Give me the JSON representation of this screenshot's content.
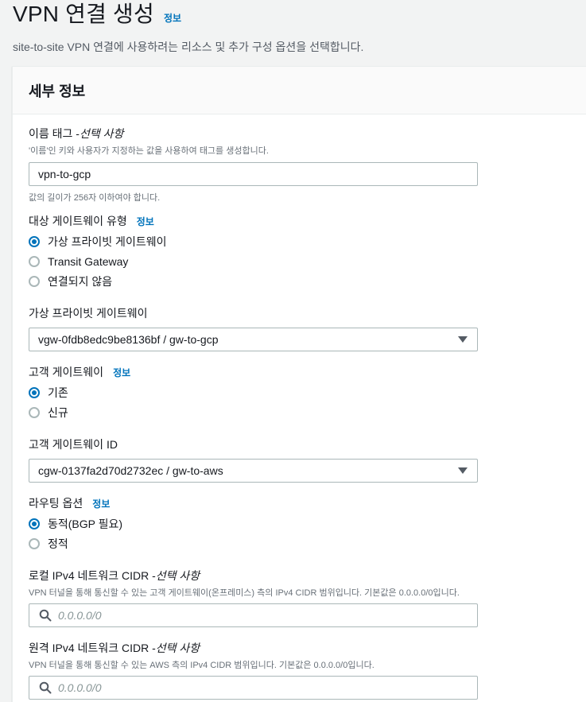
{
  "header": {
    "title": "VPN 연결 생성",
    "info": "정보",
    "description": "site-to-site VPN 연결에 사용하려는 리소스 및 추가 구성 옵션을 선택합니다."
  },
  "panel": {
    "title": "세부 정보"
  },
  "name_tag": {
    "label": "이름 태그 - ",
    "optional": "선택 사항",
    "description": "'이름'인 키와 사용자가 지정하는 값을 사용하여 태그를 생성합니다.",
    "value": "vpn-to-gcp",
    "constraint": "값의 길이가 256자 이하여야 합니다."
  },
  "target_gateway_type": {
    "label": "대상 게이트웨이 유형",
    "info": "정보",
    "options": [
      "가상 프라이빗 게이트웨이",
      "Transit Gateway",
      "연결되지 않음"
    ],
    "selected_index": 0
  },
  "virtual_private_gateway": {
    "label": "가상 프라이빗 게이트웨이",
    "value": "vgw-0fdb8edc9be8136bf / gw-to-gcp"
  },
  "customer_gateway": {
    "label": "고객 게이트웨이",
    "info": "정보",
    "options": [
      "기존",
      "신규"
    ],
    "selected_index": 0
  },
  "customer_gateway_id": {
    "label": "고객 게이트웨이 ID",
    "value": "cgw-0137fa2d70d2732ec / gw-to-aws"
  },
  "routing_options": {
    "label": "라우팅 옵션",
    "info": "정보",
    "options": [
      "동적(BGP 필요)",
      "정적"
    ],
    "selected_index": 0
  },
  "local_cidr": {
    "label": "로컬 IPv4 네트워크 CIDR - ",
    "optional": "선택 사항",
    "description": "VPN 터널을 통해 통신할 수 있는 고객 게이트웨이(온프레미스) 측의 IPv4 CIDR 범위입니다. 기본값은 0.0.0.0/0입니다.",
    "placeholder": "0.0.0.0/0"
  },
  "remote_cidr": {
    "label": "원격 IPv4 네트워크 CIDR - ",
    "optional": "선택 사항",
    "description": "VPN 터널을 통해 통신할 수 있는 AWS 측의 IPv4 CIDR 범위입니다. 기본값은 0.0.0.0/0입니다.",
    "placeholder": "0.0.0.0/0"
  },
  "colors": {
    "link": "#0073bb",
    "selected_radio": "#0073bb"
  }
}
